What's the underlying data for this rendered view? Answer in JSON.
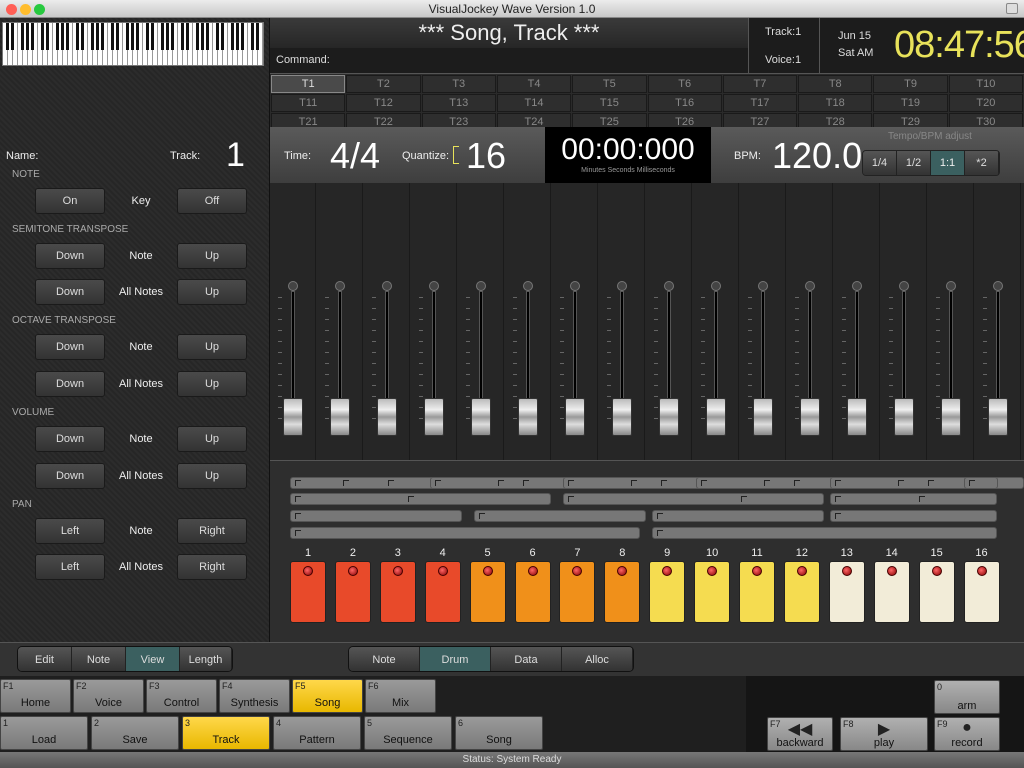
{
  "window": {
    "title": "VisualJockey Wave Version 1.0"
  },
  "header": {
    "song_title": "*** Song, Track ***",
    "command_label": "Command:",
    "track_label": "Track:1",
    "voice_label": "Voice:1",
    "date": "Jun 15",
    "day": "Sat AM",
    "clock": "08:47:56"
  },
  "tracks": [
    "T1",
    "T2",
    "T3",
    "T4",
    "T5",
    "T6",
    "T7",
    "T8",
    "T9",
    "T10",
    "T11",
    "T12",
    "T13",
    "T14",
    "T15",
    "T16",
    "T17",
    "T18",
    "T19",
    "T20",
    "T21",
    "T22",
    "T23",
    "T24",
    "T25",
    "T26",
    "T27",
    "T28",
    "T29",
    "T30"
  ],
  "selected_track": "T1",
  "info": {
    "time_label": "Time:",
    "time_value": "4/4",
    "quantize_label": "Quantize:",
    "quantize_value": "16",
    "timer": "00:00:000",
    "timer_sub": "Minutes  Seconds  Milliseconds",
    "bpm_label": "BPM:",
    "bpm_value": "120.0",
    "tempo_title": "Tempo/BPM adjust",
    "tempo_buttons": [
      "1/4",
      "1/2",
      "1:1",
      "*2"
    ],
    "tempo_selected": "1:1"
  },
  "left": {
    "name_label": "Name:",
    "track_label": "Track:",
    "track_number": "1",
    "note_title": "NOTE",
    "on": "On",
    "key": "Key",
    "off": "Off",
    "semitone_title": "SEMITONE TRANSPOSE",
    "octave_title": "OCTAVE TRANSPOSE",
    "volume_title": "VOLUME",
    "pan_title": "PAN",
    "down": "Down",
    "up": "Up",
    "left_btn": "Left",
    "right_btn": "Right",
    "note": "Note",
    "all_notes": "All Notes"
  },
  "left_tabs": [
    "Edit",
    "Note",
    "View",
    "Length"
  ],
  "left_tab_selected": "View",
  "mode_tabs": [
    "Note",
    "Drum",
    "Data",
    "Alloc"
  ],
  "mode_selected": "Drum",
  "pads": {
    "labels": [
      "1",
      "2",
      "3",
      "4",
      "5",
      "6",
      "7",
      "8",
      "9",
      "10",
      "11",
      "12",
      "13",
      "14",
      "15",
      "16"
    ],
    "colors": [
      "#e84a2a",
      "#e84a2a",
      "#e84a2a",
      "#e84a2a",
      "#f0901a",
      "#f0901a",
      "#f0901a",
      "#f0901a",
      "#f5dc50",
      "#f5dc50",
      "#f5dc50",
      "#f5dc50",
      "#f2ecd8",
      "#f2ecd8",
      "#f2ecd8",
      "#f2ecd8"
    ]
  },
  "fkeys_row1": [
    {
      "key": "F1",
      "label": "Home"
    },
    {
      "key": "F2",
      "label": "Voice"
    },
    {
      "key": "F3",
      "label": "Control"
    },
    {
      "key": "F4",
      "label": "Synthesis"
    },
    {
      "key": "F5",
      "label": "Song",
      "active": true
    },
    {
      "key": "F6",
      "label": "Mix"
    }
  ],
  "fkeys_row2": [
    {
      "key": "1",
      "label": "Load"
    },
    {
      "key": "2",
      "label": "Save"
    },
    {
      "key": "3",
      "label": "Track",
      "active": true
    },
    {
      "key": "4",
      "label": "Pattern"
    },
    {
      "key": "5",
      "label": "Sequence"
    },
    {
      "key": "6",
      "label": "Song"
    }
  ],
  "transport": {
    "arm_key": "0",
    "arm": "arm",
    "backward_key": "F7",
    "backward": "backward",
    "play_key": "F8",
    "play": "play",
    "record_key": "F9",
    "record": "record"
  },
  "status": "Status:  System Ready"
}
